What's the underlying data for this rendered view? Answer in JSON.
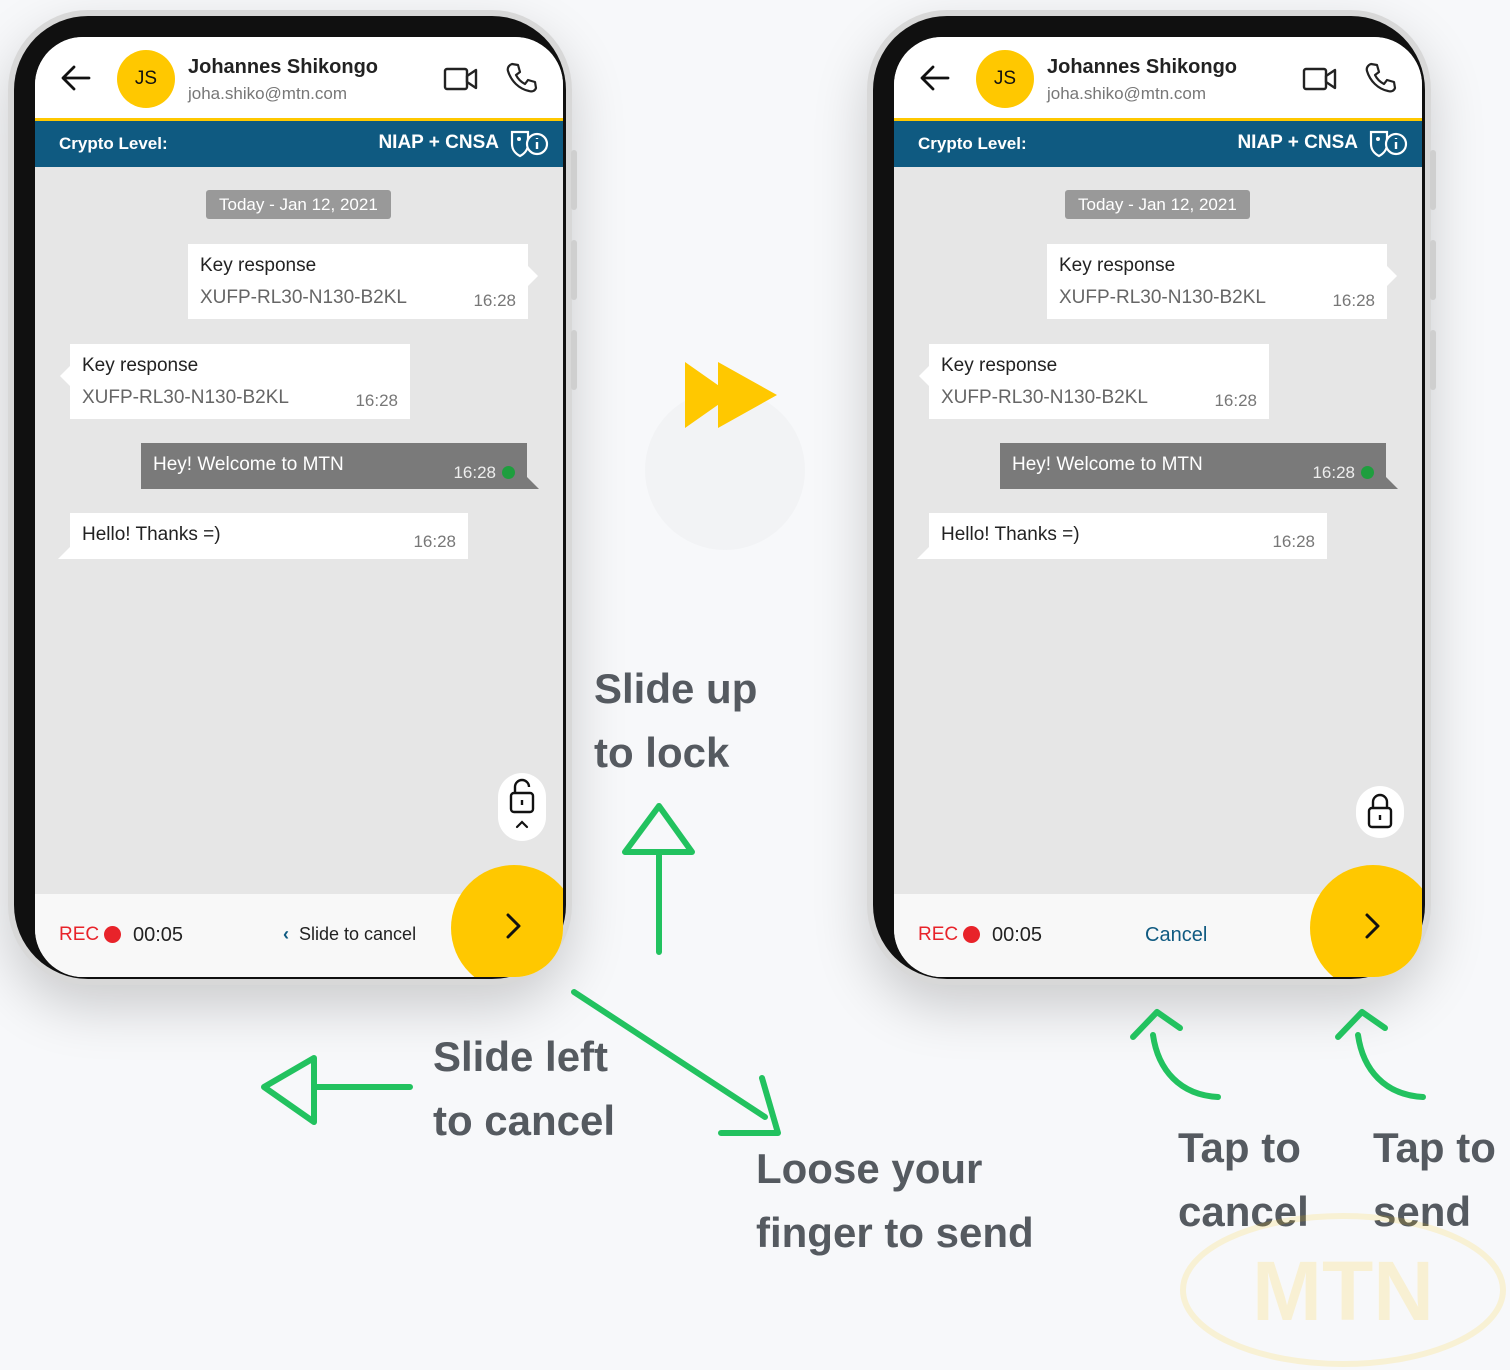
{
  "colors": {
    "brand_yellow": "#ffc800",
    "crypto_bar": "#0f5a81",
    "rec_red": "#e8232a",
    "annotation_arrow": "#22c25f",
    "annotation_text": "#555a60"
  },
  "phones": [
    {
      "contact": {
        "initials": "JS",
        "name": "Johannes Shikongo",
        "email": "joha.shiko@mtn.com"
      },
      "crypto": {
        "label": "Crypto Level:",
        "value": "NIAP + CNSA"
      },
      "date_chip": "Today - Jan 12, 2021",
      "messages": [
        {
          "title": "Key response",
          "body": "XUFP-RL30-N130-B2KL",
          "time": "16:28"
        },
        {
          "title": "Key response",
          "body": "XUFP-RL30-N130-B2KL",
          "time": "16:28"
        },
        {
          "text": "Hey! Welcome to MTN",
          "time": "16:28"
        },
        {
          "text": "Hello! Thanks =)",
          "time": "16:28"
        }
      ],
      "recording": {
        "rec_label": "REC",
        "timer": "00:05",
        "slide_text": "Slide to cancel"
      }
    },
    {
      "contact": {
        "initials": "JS",
        "name": "Johannes Shikongo",
        "email": "joha.shiko@mtn.com"
      },
      "crypto": {
        "label": "Crypto Level:",
        "value": "NIAP + CNSA"
      },
      "date_chip": "Today - Jan 12, 2021",
      "messages": [
        {
          "title": "Key response",
          "body": "XUFP-RL30-N130-B2KL",
          "time": "16:28"
        },
        {
          "title": "Key response",
          "body": "XUFP-RL30-N130-B2KL",
          "time": "16:28"
        },
        {
          "text": "Hey! Welcome to MTN",
          "time": "16:28"
        },
        {
          "text": "Hello! Thanks =)",
          "time": "16:28"
        }
      ],
      "recording": {
        "rec_label": "REC",
        "timer": "00:05",
        "cancel_label": "Cancel"
      }
    }
  ],
  "annotations": {
    "slide_up": "Slide up\nto lock",
    "slide_left": "Slide left\nto cancel",
    "release": "Loose your\nfinger to send",
    "tap_cancel": "Tap to\ncancel",
    "tap_send": "Tap to\nsend"
  },
  "watermark": "MTN",
  "icons": {
    "back": "arrow-left-icon",
    "video": "video-camera-icon",
    "call": "phone-icon",
    "shield": "shield-info-icon",
    "lock_open": "unlock-icon",
    "lock_closed": "lock-icon",
    "send": "chevron-right-icon",
    "transition": "fast-forward-icon"
  }
}
